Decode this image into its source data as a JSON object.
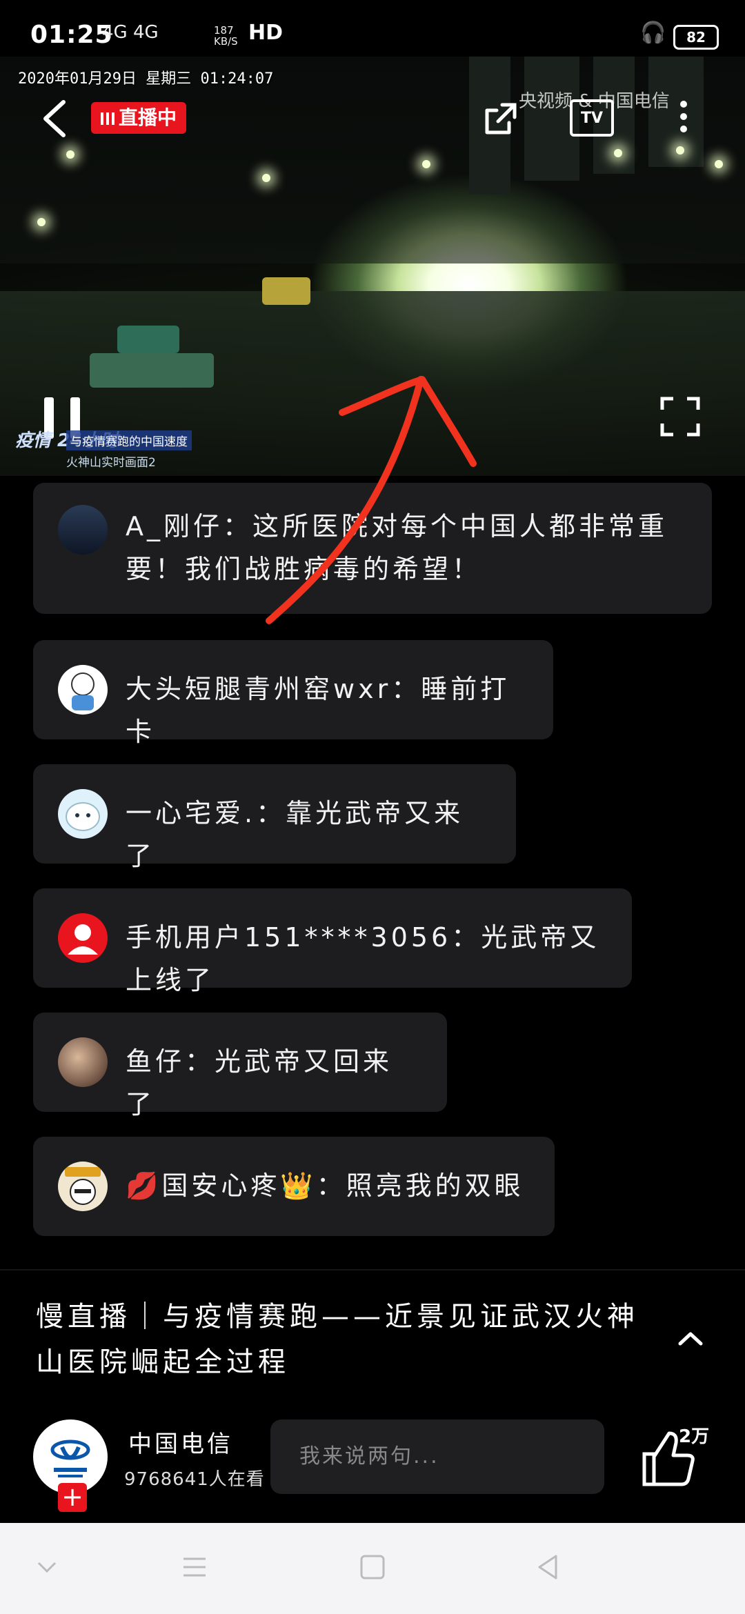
{
  "status_bar": {
    "time": "01:25",
    "network": "4G 4G",
    "speed_value": "187",
    "speed_unit": "KB/S",
    "hd": "HD",
    "battery": "82"
  },
  "player": {
    "timestamp": "2020年01月29日  星期三  01:24:07",
    "live_badge": "直播中",
    "watermark": "央视频 & 中国电信",
    "tv_label": "TV",
    "brand_text": "疫情 24小时",
    "subtitle_line1": "与疫情赛跑的中国速度",
    "subtitle_line2": "火神山实时画面2"
  },
  "comments": [
    {
      "text": "A_刚仔：这所医院对每个中国人都非常重要！我们战胜病毒的希望！",
      "avatar": "car-avatar"
    },
    {
      "text": "大头短腿青州窑wxr：睡前打卡",
      "avatar": "cartoon-avatar"
    },
    {
      "text": "一心宅爱.：靠光武帝又来了",
      "avatar": "snow-avatar"
    },
    {
      "text": "手机用户151****3056：光武帝又上线了",
      "avatar": "default-user-avatar"
    },
    {
      "text": "鱼仔：光武帝又回来了",
      "avatar": "photo-avatar"
    },
    {
      "text": "💋国安心疼👑：照亮我的双眼",
      "avatar": "meme-avatar"
    }
  ],
  "program": {
    "title": "慢直播｜与疫情赛跑——近景见证武汉火神山医院崛起全过程"
  },
  "channel": {
    "name": "中国电信",
    "viewers": "9768641人在看",
    "input_placeholder": "我来说两句...",
    "like_count": "2万"
  },
  "nav": {
    "items": [
      "down-icon",
      "menu-icon",
      "home-icon",
      "back-icon"
    ]
  },
  "colors": {
    "live_red": "#e8151e",
    "comment_bg": "#1d1d1f",
    "annotation_arrow": "#f0321e"
  }
}
